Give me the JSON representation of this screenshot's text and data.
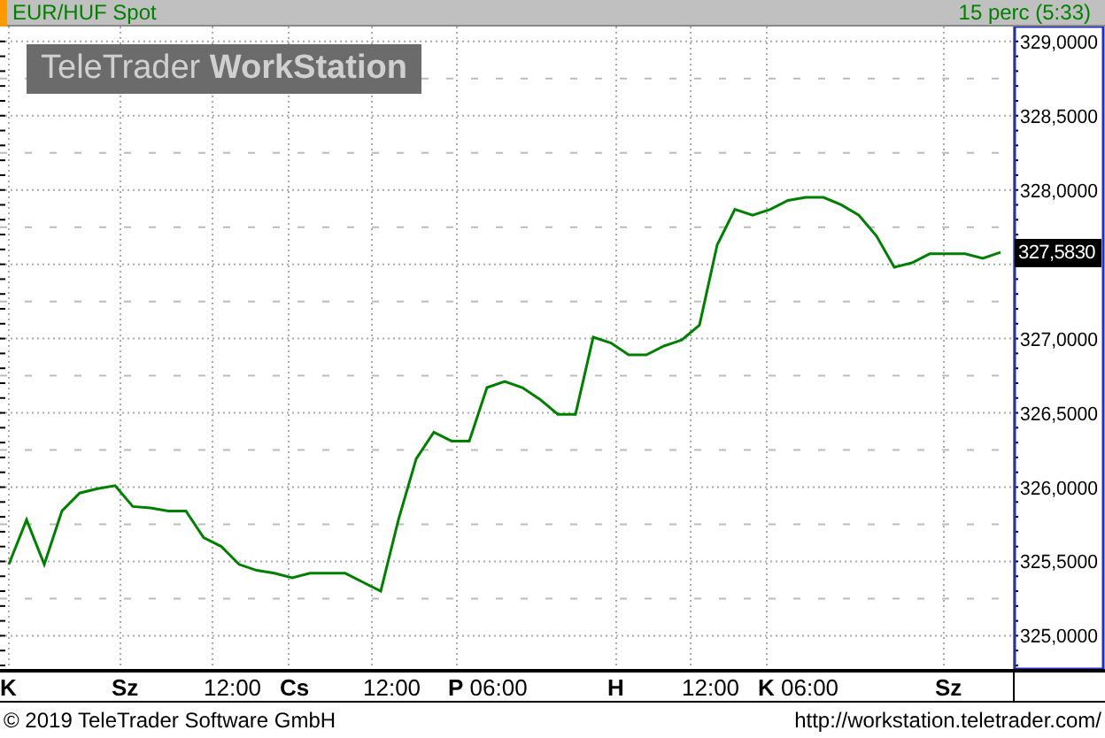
{
  "header": {
    "title": "EUR/HUF Spot",
    "interval": "15 perc (5:33)"
  },
  "logo": "TeleTrader **WorkStation**",
  "chart": {
    "last_price": "327,5830",
    "price_axis_labels": [
      "329,0000",
      "328,5000",
      "328,0000",
      "327,0000",
      "326,5000",
      "326,0000",
      "325,5000",
      "325,0000"
    ],
    "time_axis_labels": [
      "**K**",
      "**Sz**",
      "12:00",
      "**Cs**",
      "12:00",
      "**P** 06:00",
      "**H**",
      "12:00",
      "**K** 06:00",
      "**Sz**"
    ]
  },
  "footer": {
    "copyright": "© 2019 TeleTrader Software GmbH",
    "url": "http://workstation.teletrader.com/"
  }
}
